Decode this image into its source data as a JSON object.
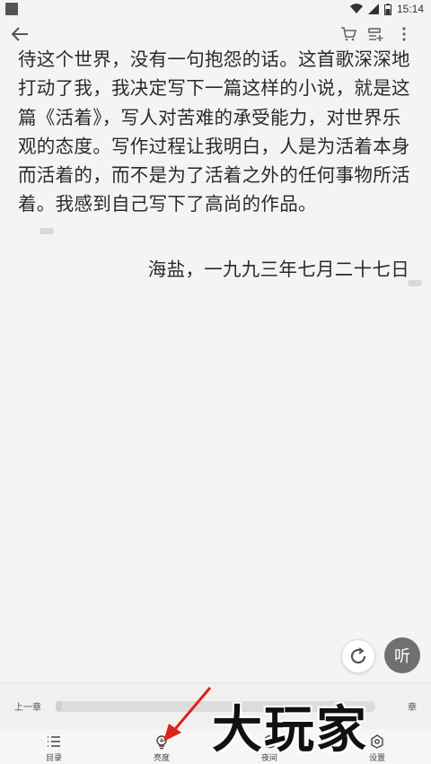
{
  "status_bar": {
    "time": "15:14"
  },
  "toolbar": {
    "back_icon": "arrow-left-icon",
    "cart_icon": "cart-icon",
    "add_list_icon": "playlist-add-icon",
    "more_icon": "more-vertical-icon"
  },
  "content": {
    "paragraph": "待这个世界，没有一句抱怨的话。这首歌深深地打动了我，我决定写下一篇这样的小说，就是这篇《活着》，写人对苦难的承受能力，对世界乐观的态度。写作过程让我明白，人是为活着本身而活着的，而不是为了活着之外的任何事物所活着。我感到自己写下了高尚的作品。",
    "signature": "海盐，一九九三年七月二十七日"
  },
  "floating": {
    "listen_label": "听"
  },
  "chapter_bar": {
    "prev_label": "上一章",
    "next_label": "章",
    "progress": 0.02
  },
  "bottom_nav": [
    {
      "label": "目录",
      "icon": "list-icon"
    },
    {
      "label": "亮度",
      "icon": "brightness-icon"
    },
    {
      "label": "夜间",
      "icon": "moon-icon"
    },
    {
      "label": "设置",
      "icon": "settings-icon"
    }
  ],
  "watermark": "大玩家"
}
